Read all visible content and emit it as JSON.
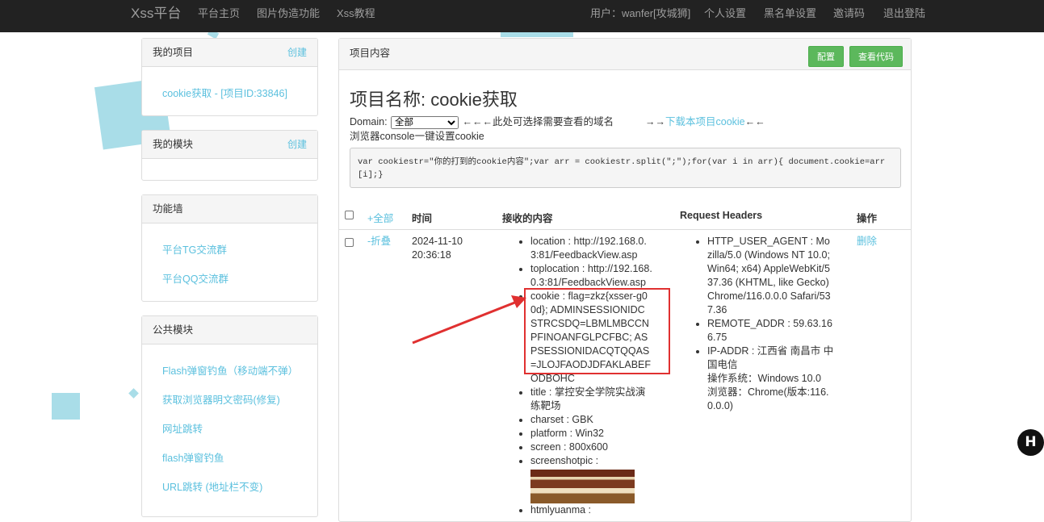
{
  "navbar": {
    "brand": "Xss平台",
    "links": [
      "平台主页",
      "图片伪造功能",
      "Xss教程"
    ],
    "user": "用户：wanfer[攻城狮]",
    "right_links": [
      "个人设置",
      "黑名单设置",
      "邀请码",
      "退出登陆"
    ]
  },
  "sidebar": {
    "my_project": {
      "title": "我的项目",
      "action": "创建",
      "items": [
        "cookie获取 - [项目ID:33846]"
      ]
    },
    "my_module": {
      "title": "我的模块",
      "action": "创建"
    },
    "features": {
      "title": "功能墙",
      "items": [
        "平台TG交流群",
        "平台QQ交流群"
      ]
    },
    "public_modules": {
      "title": "公共模块",
      "items": [
        "Flash弹窗钓鱼（移动端不弹）",
        "获取浏览器明文密码(修复)",
        "网址跳转",
        "flash弹窗钓鱼",
        "URL跳转 (地址栏不变)"
      ]
    }
  },
  "main": {
    "heading": "项目内容",
    "btn_config": "配置",
    "btn_view_code": "查看代码",
    "project_title": "项目名称: cookie获取",
    "domain_label": "Domain:",
    "domain_selected": "全部",
    "domain_hint": "←←←此处可选择需要查看的域名",
    "download_prefix": "→→",
    "download_link": "下载本项目cookie",
    "download_suffix": "←←",
    "console_hint": "浏览器console一键设置cookie",
    "code": "var cookiestr=\"你的打到的cookie内容\";var arr = cookiestr.split(\";\");for(var i in arr){ document.cookie=arr[i];}"
  },
  "table": {
    "headers": {
      "all": "+全部",
      "time": "时间",
      "content": "接收的内容",
      "headers": "Request Headers",
      "ops": "操作"
    },
    "row": {
      "fold": "-折叠",
      "date": "2024-11-10",
      "time": "20:36:18",
      "content": [
        "location : http://192.168.0.3:81/FeedbackView.asp",
        "toplocation : http://192.168.0.3:81/FeedbackView.asp",
        "cookie : flag=zkz{xsser-g00d}; ADMINSESSIONIDCSTRCSDQ=LBMLMBCCNPFINOANFGLPCFBC; ASPSESSIONIDACQTQQAS=JLOJFAODJDFAKLABEFODBOHC",
        "title : 掌控安全学院实战演练靶场",
        "charset : GBK",
        "platform : Win32",
        "screen : 800x600",
        "screenshotpic :",
        "htmlyuanma :"
      ],
      "headers": [
        "HTTP_USER_AGENT : Mozilla/5.0 (Windows NT 10.0; Win64; x64) AppleWebKit/537.36 (KHTML, like Gecko) Chrome/116.0.0.0 Safari/537.36",
        "REMOTE_ADDR : 59.63.166.75",
        "IP-ADDR : 江西省 南昌市 中国电信"
      ],
      "os_line": "操作系统：Windows 10.0",
      "browser_line": "浏览器：Chrome(版本:116.0.0.0)",
      "delete": "删除"
    }
  },
  "colors": {
    "navbar_bg": "#222222",
    "link": "#5bc0de",
    "green_btn": "#5cb85c",
    "highlight": "#e03030",
    "bg_shape": "#a9dde8"
  },
  "icons": {
    "badge": "h-logo-icon",
    "arrow": "red-arrow-annotation"
  }
}
